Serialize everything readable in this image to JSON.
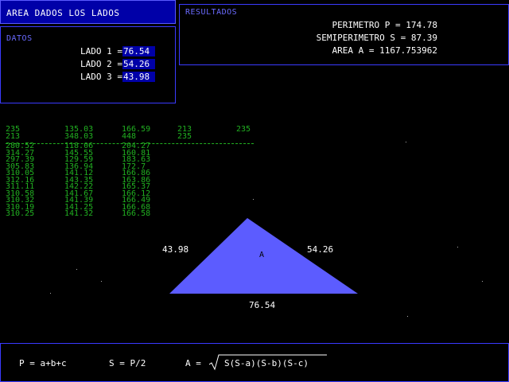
{
  "title": "AREA DADOS LOS LADOS",
  "datos": {
    "label": "DATOS",
    "rows": [
      {
        "label": "LADO 1 =",
        "value": "76.54"
      },
      {
        "label": "LADO 2 =",
        "value": "54.26"
      },
      {
        "label": "LADO 3 =",
        "value": "43.98"
      }
    ]
  },
  "resultados": {
    "label": "RESULTADOS",
    "rows": [
      "PERIMETRO P = 174.78",
      "SEMIPERIMETRO S = 87.39",
      "AREA A = 1167.753962"
    ]
  },
  "table": {
    "header": [
      [
        "235",
        "135.03",
        "166.59",
        "213",
        "235"
      ],
      [
        "213",
        "348.03",
        "448",
        "235",
        ""
      ]
    ],
    "rows": [
      [
        "280.52",
        "118.06",
        "204.27"
      ],
      [
        "314.27",
        "145.55",
        "160.81"
      ],
      [
        "297.39",
        "129.59",
        "183.63"
      ],
      [
        "305.83",
        "136.94",
        "172.7"
      ],
      [
        "310.05",
        "141.12",
        "166.86"
      ],
      [
        "312.16",
        "143.35",
        "163.86"
      ],
      [
        "311.11",
        "142.22",
        "165.37"
      ],
      [
        "310.58",
        "141.67",
        "166.12"
      ],
      [
        "310.32",
        "141.39",
        "166.49"
      ],
      [
        "310.19",
        "141.25",
        "166.68"
      ],
      [
        "310.25",
        "141.32",
        "166.58"
      ]
    ]
  },
  "triangle": {
    "left_label": "43.98",
    "right_label": "54.26",
    "bottom_label": "76.54",
    "center_label": "A",
    "color": "#5c5cff"
  },
  "formulas": {
    "perimeter": "P = a+b+c",
    "semi": "S = P/2",
    "area_prefix": "A =",
    "area_radicand": "S(S-a)(S-b)(S-c)"
  }
}
